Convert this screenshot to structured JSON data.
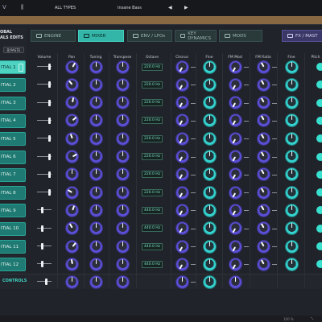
{
  "topbar": {
    "logo": "V",
    "library_icon": "library-icon",
    "types": "ALL TYPES",
    "preset": "Insane Bass",
    "prev_arrow": "◀",
    "next_arrow": "▶"
  },
  "left": {
    "global_title_line1": "OBAL",
    "global_title_line2": "ALS EDITS",
    "paste_label": "PASTE",
    "partials": [
      "ITIAL 1",
      "ITIAL 2",
      "ITIAL 3",
      "ITIAL 4",
      "ITIAL 5",
      "ITIAL 6",
      "ITIAL 7",
      "ITIAL 8",
      "ITIAL 9",
      "ITIAL 10",
      "ITIAL 11",
      "ITIAL 12"
    ],
    "selected_partial": 0,
    "global_controls": "CONTROLS"
  },
  "tabs": [
    {
      "label": "ENGINE",
      "icon": "engine-icon"
    },
    {
      "label": "MIXER",
      "icon": "mixer-icon",
      "active": true
    },
    {
      "label": "ENV / LFOs",
      "icon": "envelope-icon"
    },
    {
      "label": "KEY DYNAMICS",
      "icon": "keyboard-icon"
    },
    {
      "label": "MODS",
      "icon": "mods-icon"
    },
    {
      "label": "FX / MAST",
      "icon": "fx-icon"
    }
  ],
  "columns": {
    "volume": "Volume",
    "pan": "Pan",
    "tuning": "Tuning",
    "transpose": "Transpose",
    "octave": "Octave",
    "chorus": "Chorus",
    "fine1": "Fine",
    "fm_mod": "FM Mod",
    "fm_ratio": "FM Ratio",
    "fine2": "Fine",
    "pitch": "Pitch"
  },
  "octave_values": [
    "220.0 Hz",
    "220.0 Hz",
    "220.0 Hz",
    "220.0 Hz",
    "220.0 Hz",
    "220.0 Hz",
    "220.0 Hz",
    "220.0 Hz",
    "440.0 Hz",
    "440.0 Hz",
    "440.0 Hz",
    "440.0 Hz"
  ],
  "footer": {
    "zoom": "100 %",
    "resize_icon": "resize-icon"
  },
  "colors": {
    "accent": "#33b6a8",
    "knob": "#5b4fd8",
    "knob_cyan": "#35d3d0",
    "fx_tab": "#3b3868"
  }
}
